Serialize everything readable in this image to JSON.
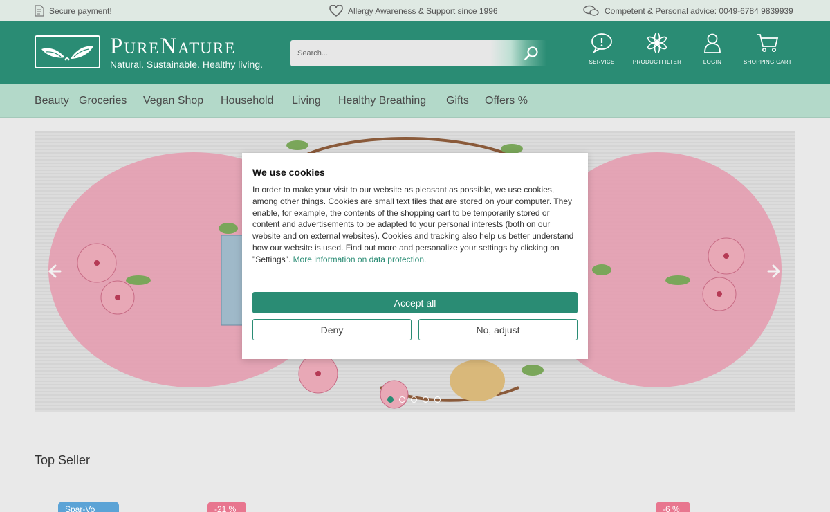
{
  "topbar": {
    "secure": "Secure payment!",
    "allergy": "Allergy Awareness & Support since 1996",
    "advice": "Competent & Personal advice: 0049-6784 9839939"
  },
  "header": {
    "brand": "PureNature",
    "tagline": "Natural. Sustainable. Healthy living.",
    "search_placeholder": "Search...",
    "icons": [
      {
        "label": "Service",
        "icon": "service-bubble-icon"
      },
      {
        "label": "Productfilter",
        "icon": "flower-filter-icon"
      },
      {
        "label": "Login",
        "icon": "user-icon"
      },
      {
        "label": "Shopping cart",
        "icon": "cart-icon"
      }
    ]
  },
  "nav": [
    "Beauty",
    "Groceries",
    "Vegan Shop",
    "Household",
    "Living",
    "Healthy Breathing",
    "Gifts",
    "Offers %"
  ],
  "cookie": {
    "title": "We use cookies",
    "body": "In order to make your visit to our website as pleasant as possible, we use cookies, among other things. Cookies are small text files that are stored on your computer. They enable, for example, the contents of the shopping cart to be temporarily stored or content and advertisements to be adapted to your personal interests (both on our website and on external websites). Cookies and tracking also help us better understand how our website is used. Find out more and personalize your settings by clicking on \"Settings\".",
    "link": "More information on data protection.",
    "accept": "Accept all",
    "deny": "Deny",
    "adjust": "No, adjust"
  },
  "slider": {
    "slides": 5,
    "active": 1
  },
  "section": {
    "title": "Top Seller"
  },
  "badges": [
    "Spar-Vo",
    "-21 %",
    "-6 %"
  ],
  "colors": {
    "brand": "#2a8c74",
    "nav_bg": "#b3d9c9",
    "topbar_bg": "#dfe9e3",
    "blossom": "#e59aae"
  }
}
